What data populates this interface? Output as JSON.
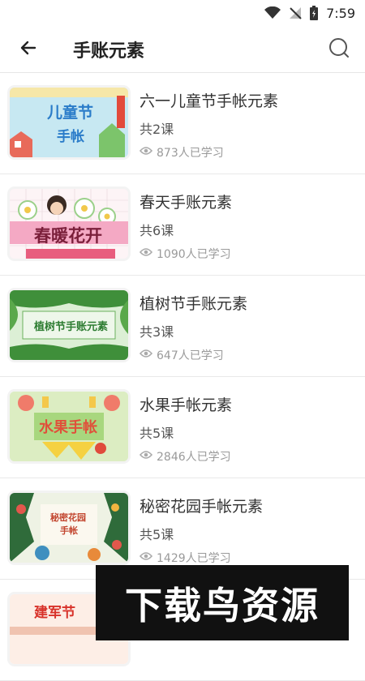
{
  "status_bar": {
    "time": "7:59"
  },
  "header": {
    "title": "手账元素"
  },
  "courses": [
    {
      "title": "六一儿童节手帐元素",
      "lessons": "共2课",
      "learners": "873人已学习",
      "thumb_text": [
        "儿童节",
        "手帐"
      ]
    },
    {
      "title": "春天手账元素",
      "lessons": "共6课",
      "learners": "1090人已学习",
      "thumb_text": [
        "春暖花开"
      ]
    },
    {
      "title": "植树节手账元素",
      "lessons": "共3课",
      "learners": "647人已学习",
      "thumb_text": [
        "植树节手账元素"
      ]
    },
    {
      "title": "水果手帐元素",
      "lessons": "共5课",
      "learners": "2846人已学习",
      "thumb_text": [
        "水果手帐"
      ]
    },
    {
      "title": "秘密花园手帐元素",
      "lessons": "共5课",
      "learners": "1429人已学习",
      "thumb_text": [
        "秘密花园",
        "手帐"
      ]
    },
    {
      "title": "",
      "lessons": "",
      "learners": "",
      "thumb_text": [
        "建军节"
      ]
    }
  ],
  "watermark": {
    "text": "下载鸟资源"
  },
  "icons": {
    "back": "arrow-left-icon",
    "search": "search-icon",
    "eye": "eye-icon",
    "wifi": "wifi-icon",
    "signal": "signal-icon",
    "battery": "battery-icon"
  }
}
